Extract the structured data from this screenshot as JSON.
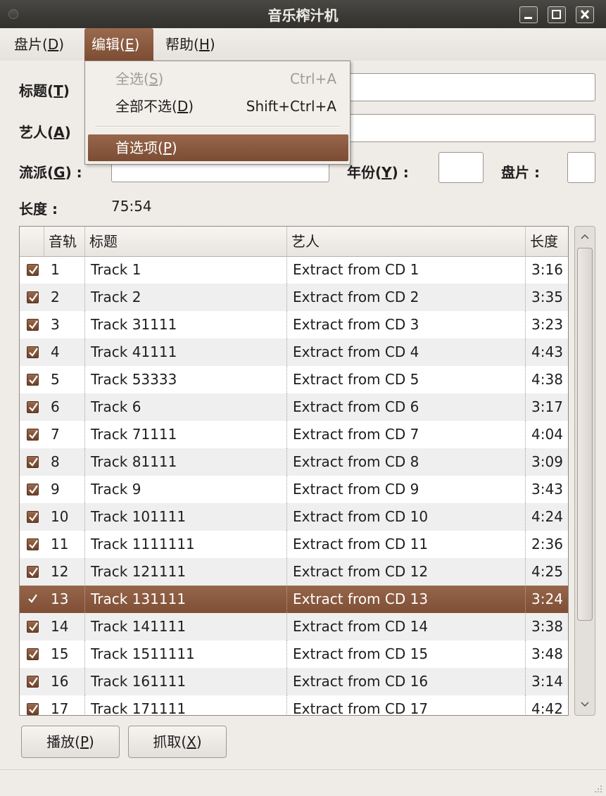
{
  "window": {
    "title": "音乐榨汁机"
  },
  "menubar": [
    {
      "pre": "盘片(",
      "key": "D",
      "post": ")"
    },
    {
      "pre": "编辑(",
      "key": "E",
      "post": ")"
    },
    {
      "pre": "帮助(",
      "key": "H",
      "post": ")"
    }
  ],
  "form": {
    "title_label": {
      "pre": "标题(",
      "key": "T",
      "post": ")"
    },
    "artist_label": {
      "pre": "艺人(",
      "key": "A",
      "post": ")"
    },
    "genre_label": {
      "pre": "流派(",
      "key": "G",
      "post": ") :"
    },
    "year_label": {
      "pre": "年份(",
      "key": "Y",
      "post": ") :"
    },
    "disc_label": "盘片 :",
    "length_label": "长度 :",
    "length_value": "75:54",
    "title_value": "",
    "artist_value": "",
    "genre_value": "",
    "year_value": "",
    "disc_value": ""
  },
  "edit_menu": {
    "select_all": {
      "pre": "全选(",
      "key": "S",
      "post": ")",
      "accel": "Ctrl+A",
      "enabled": false
    },
    "deselect_all": {
      "pre": "全部不选(",
      "key": "D",
      "post": ")",
      "accel": "Shift+Ctrl+A",
      "enabled": true
    },
    "preferences": {
      "pre": "首选项(",
      "key": "P",
      "post": ")",
      "highlighted": true
    }
  },
  "tracklist": {
    "columns": [
      "音轨",
      "标题",
      "艺人",
      "长度"
    ],
    "selected_index": 12,
    "rows": [
      {
        "num": "1",
        "title": "Track 1",
        "artist": "Extract from CD 1",
        "length": "3:16",
        "checked": true
      },
      {
        "num": "2",
        "title": "Track 2",
        "artist": "Extract from CD 2",
        "length": "3:35",
        "checked": true
      },
      {
        "num": "3",
        "title": "Track 31111",
        "artist": "Extract from CD 3",
        "length": "3:23",
        "checked": true
      },
      {
        "num": "4",
        "title": "Track 41111",
        "artist": "Extract from CD 4",
        "length": "4:43",
        "checked": true
      },
      {
        "num": "5",
        "title": "Track 53333",
        "artist": "Extract from CD 5",
        "length": "4:38",
        "checked": true
      },
      {
        "num": "6",
        "title": "Track 6",
        "artist": "Extract from CD 6",
        "length": "3:17",
        "checked": true
      },
      {
        "num": "7",
        "title": "Track 71111",
        "artist": "Extract from CD 7",
        "length": "4:04",
        "checked": true
      },
      {
        "num": "8",
        "title": "Track 81111",
        "artist": "Extract from CD 8",
        "length": "3:09",
        "checked": true
      },
      {
        "num": "9",
        "title": "Track 9",
        "artist": "Extract from CD 9",
        "length": "3:43",
        "checked": true
      },
      {
        "num": "10",
        "title": "Track 101111",
        "artist": "Extract from CD 10",
        "length": "4:24",
        "checked": true
      },
      {
        "num": "11",
        "title": "Track 1111111",
        "artist": "Extract from CD 11",
        "length": "2:36",
        "checked": true
      },
      {
        "num": "12",
        "title": "Track 121111",
        "artist": "Extract from CD 12",
        "length": "4:25",
        "checked": true
      },
      {
        "num": "13",
        "title": "Track 131111",
        "artist": "Extract from CD 13",
        "length": "3:24",
        "checked": true
      },
      {
        "num": "14",
        "title": "Track 141111",
        "artist": "Extract from CD 14",
        "length": "3:38",
        "checked": true
      },
      {
        "num": "15",
        "title": "Track 1511111",
        "artist": "Extract from CD 15",
        "length": "3:48",
        "checked": true
      },
      {
        "num": "16",
        "title": "Track 161111",
        "artist": "Extract from CD 16",
        "length": "3:14",
        "checked": true
      },
      {
        "num": "17",
        "title": "Track 171111",
        "artist": "Extract from CD 17",
        "length": "4:42",
        "checked": true
      }
    ]
  },
  "buttons": {
    "play": {
      "pre": "播放(",
      "key": "P",
      "post": ")"
    },
    "extract": {
      "pre": "抓取(",
      "key": "X",
      "post": ")"
    }
  },
  "colors": {
    "accent": "#8b5a3e",
    "window_bg": "#efebe7",
    "row_alt": "#efefef"
  }
}
